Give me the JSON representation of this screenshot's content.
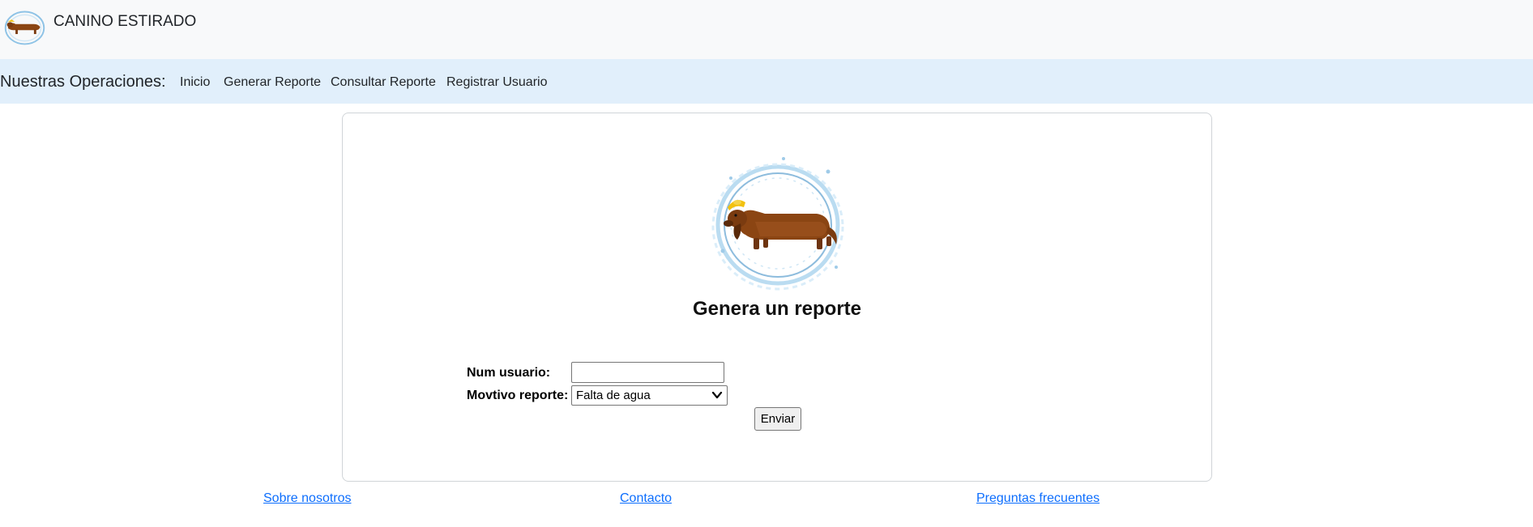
{
  "header": {
    "brand_name": "CANINO ESTIRADO",
    "logo_icon": "stretched-dachshund-water-ring-logo"
  },
  "nav": {
    "heading": "Nuestras Operaciones:",
    "links": [
      "Inicio",
      "Generar Reporte",
      "Consultar Reporte",
      "Registrar Usuario"
    ]
  },
  "main": {
    "title": "Genera un reporte",
    "form": {
      "user_label": "Num usuario:",
      "user_value": "",
      "reason_label": "Movtivo reporte:",
      "reason_selected": "Falta de agua",
      "submit_label": "Enviar"
    }
  },
  "footer": {
    "links": [
      "Sobre nosotros",
      "Contacto",
      "Preguntas frecuentes"
    ]
  },
  "colors": {
    "topbar_bg": "#f8f9fa",
    "navbar_bg": "#e1effb",
    "link_blue": "#0d6efd"
  }
}
